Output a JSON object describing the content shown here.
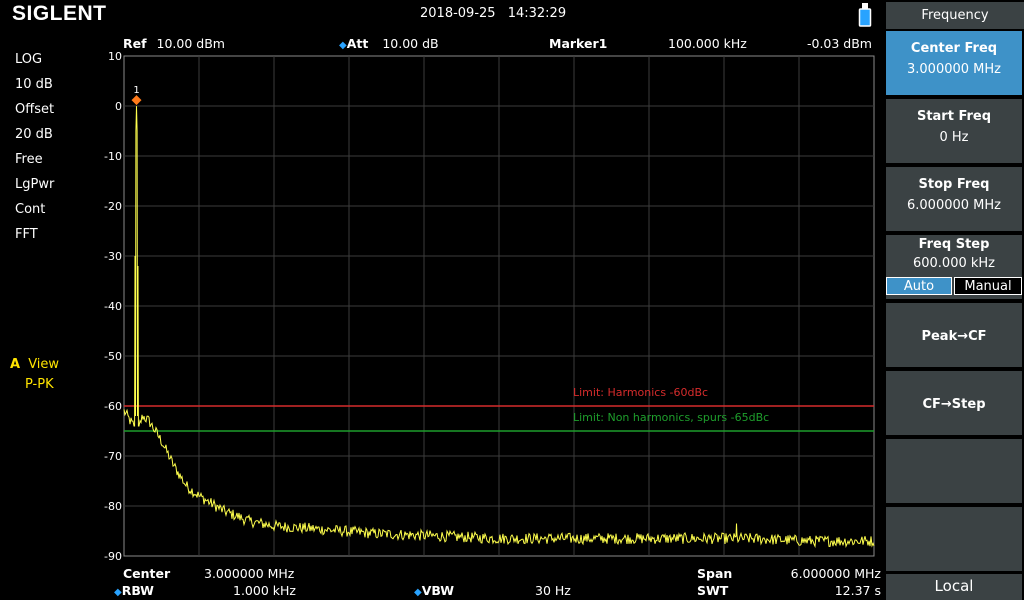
{
  "header": {
    "brand": "SIGLENT",
    "date": "2018-09-25",
    "time": "14:32:29"
  },
  "left_panel": {
    "scale_type": "LOG",
    "scale_div": "10 dB",
    "offset_label": "Offset",
    "offset_value": "20 dB",
    "trig": "Free",
    "detector": "LgPwr",
    "sweep": "Cont",
    "sweep_mode": "FFT",
    "trace_id": "A",
    "trace_mode": "View",
    "trace_detector": "P-PK"
  },
  "top_info": {
    "ref_label": "Ref",
    "ref_value": "10.00 dBm",
    "att_label": "Att",
    "att_value": "10.00 dB",
    "marker_label": "Marker1",
    "marker_freq": "100.000 kHz",
    "marker_level": "-0.03 dBm"
  },
  "bottom_info": {
    "center_label": "Center",
    "center_value": "3.000000 MHz",
    "span_label": "Span",
    "span_value": "6.000000 MHz",
    "rbw_label": "RBW",
    "rbw_value": "1.000 kHz",
    "vbw_label": "VBW",
    "vbw_value": "30 Hz",
    "swt_label": "SWT",
    "swt_value": "12.37 s"
  },
  "menu": {
    "title": "Frequency",
    "center_freq_label": "Center Freq",
    "center_freq_value": "3.000000 MHz",
    "start_freq_label": "Start Freq",
    "start_freq_value": "0 Hz",
    "stop_freq_label": "Stop Freq",
    "stop_freq_value": "6.000000 MHz",
    "freq_step_label": "Freq Step",
    "freq_step_value": "600.000 kHz",
    "auto_label": "Auto",
    "manual_label": "Manual",
    "peak_cf_label": "Peak→CF",
    "cf_step_label": "CF→Step",
    "local_label": "Local"
  },
  "chart_data": {
    "type": "line",
    "y_ticks": [
      "10",
      "0",
      "-10",
      "-20",
      "-30",
      "-40",
      "-50",
      "-60",
      "-70",
      "-80",
      "-90"
    ],
    "ylim": [
      -90,
      10
    ],
    "xlim_mhz": [
      0,
      6
    ],
    "grid": true,
    "marker": {
      "label": "1",
      "x_mhz": 0.1,
      "y_dbm": -0.03
    },
    "limits": [
      {
        "name": "Limit: Harmonics -60dBc",
        "y_dbm": -60,
        "color": "#d62c2c"
      },
      {
        "name": "Limit: Non harmonics, spurs -65dBc",
        "y_dbm": -65,
        "color": "#1e9e2c"
      }
    ],
    "trace_color": "#ffff4d",
    "series": [
      {
        "x_mhz": [
          0.0,
          0.05,
          0.08,
          0.09,
          0.1,
          0.11,
          0.12,
          0.15,
          0.2,
          0.3,
          0.4,
          0.5,
          0.6,
          0.8,
          1.0,
          1.2,
          1.5,
          2.0,
          2.5,
          3.0,
          3.5,
          4.0,
          4.5,
          5.0,
          5.5,
          6.0
        ],
        "y_dbm": [
          -61,
          -63,
          -64,
          -30,
          -0.03,
          -31,
          -64,
          -62,
          -63,
          -67,
          -72,
          -76,
          -78,
          -81,
          -83,
          -84,
          -84.5,
          -85.5,
          -86,
          -86.5,
          -86.5,
          -86.5,
          -86.5,
          -86.5,
          -87,
          -87
        ]
      }
    ],
    "spurs": [
      {
        "x_mhz": 4.9,
        "y_dbm": -83.5
      }
    ]
  }
}
